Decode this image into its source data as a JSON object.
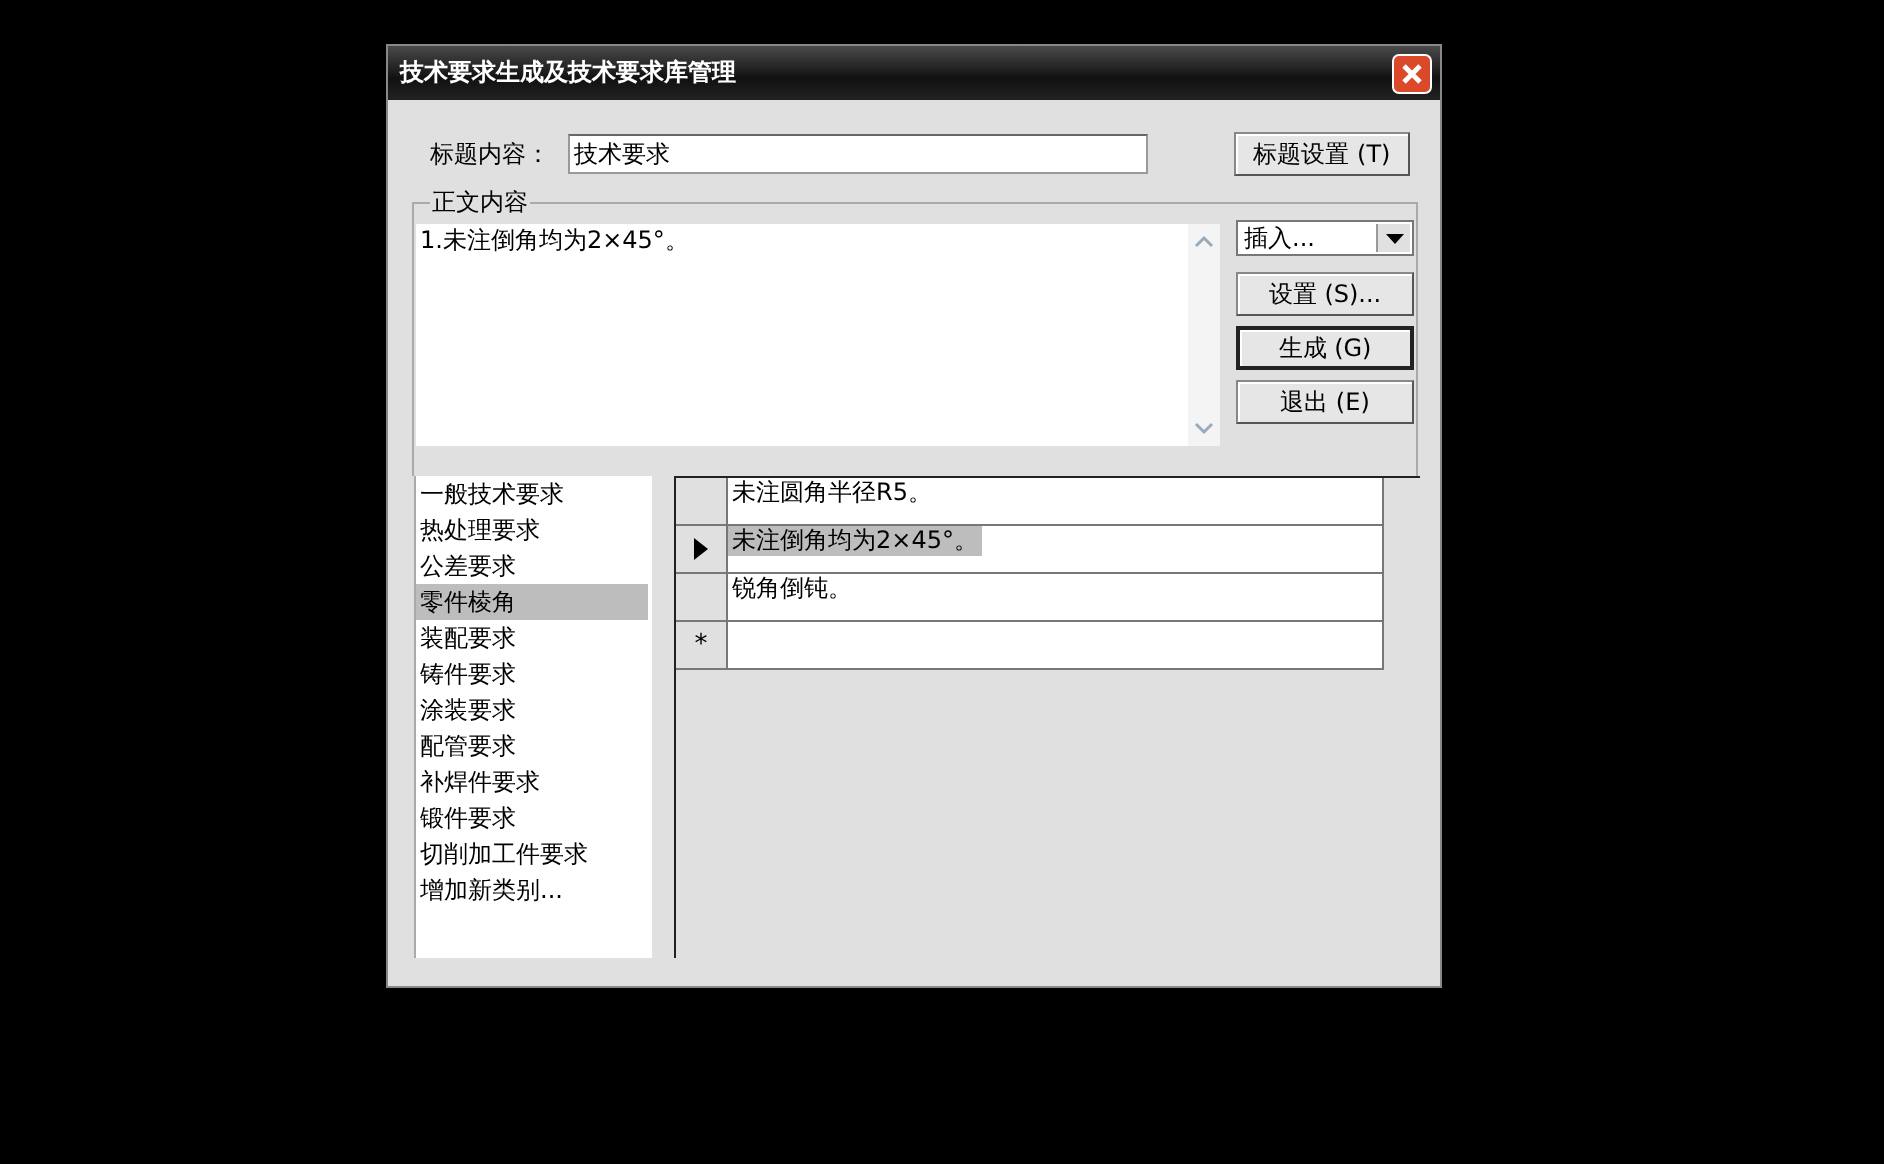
{
  "window": {
    "title": "技术要求生成及技术要求库管理"
  },
  "title_field": {
    "label": "标题内容：",
    "value": "技术要求"
  },
  "title_settings_button": {
    "label": "标题设置 (T)"
  },
  "body": {
    "legend": "正文内容",
    "text": "1.未注倒角均为2×45°。"
  },
  "insert_dropdown": {
    "value": "插入..."
  },
  "buttons": [
    {
      "label": "设置 (S)...",
      "default": false
    },
    {
      "label": "生成 (G)",
      "default": true
    },
    {
      "label": "退出 (E)",
      "default": false
    }
  ],
  "categories": [
    {
      "label": "一般技术要求",
      "selected": false
    },
    {
      "label": "热处理要求",
      "selected": false
    },
    {
      "label": "公差要求",
      "selected": false
    },
    {
      "label": "零件棱角",
      "selected": true
    },
    {
      "label": "装配要求",
      "selected": false
    },
    {
      "label": "铸件要求",
      "selected": false
    },
    {
      "label": "涂装要求",
      "selected": false
    },
    {
      "label": "配管要求",
      "selected": false
    },
    {
      "label": "补焊件要求",
      "selected": false
    },
    {
      "label": "锻件要求",
      "selected": false
    },
    {
      "label": "切削加工件要求",
      "selected": false
    },
    {
      "label": "增加新类别...",
      "selected": false
    }
  ],
  "grid": {
    "rows": [
      {
        "text": "未注圆角半径R5。",
        "selected": false
      },
      {
        "text": "未注倒角均为2×45°。",
        "selected": true
      },
      {
        "text": "锐角倒钝。",
        "selected": false
      }
    ],
    "new_row_marker": "*"
  }
}
